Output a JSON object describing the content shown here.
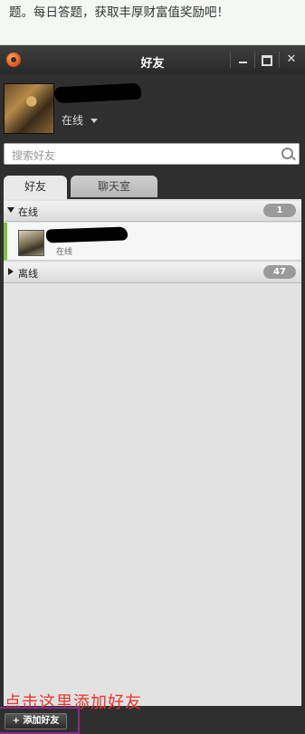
{
  "article": {
    "text": "题。每日答题，获取丰厚财富值奖励吧！"
  },
  "window": {
    "title": "好友"
  },
  "profile": {
    "status": "在线"
  },
  "search": {
    "placeholder": "搜索好友"
  },
  "tabs": [
    {
      "label": "好友"
    },
    {
      "label": "聊天室"
    }
  ],
  "groups": [
    {
      "label": "在线",
      "count": "1"
    },
    {
      "label": "离线",
      "count": "47"
    }
  ],
  "friends": [
    {
      "status": "在线"
    }
  ],
  "annotation": {
    "text": "点击这里添加好友"
  },
  "footer": {
    "add_friend_label": "+ 添加好友"
  },
  "colors": {
    "online_accent": "#7bc043",
    "annotation": "#e6372b"
  }
}
